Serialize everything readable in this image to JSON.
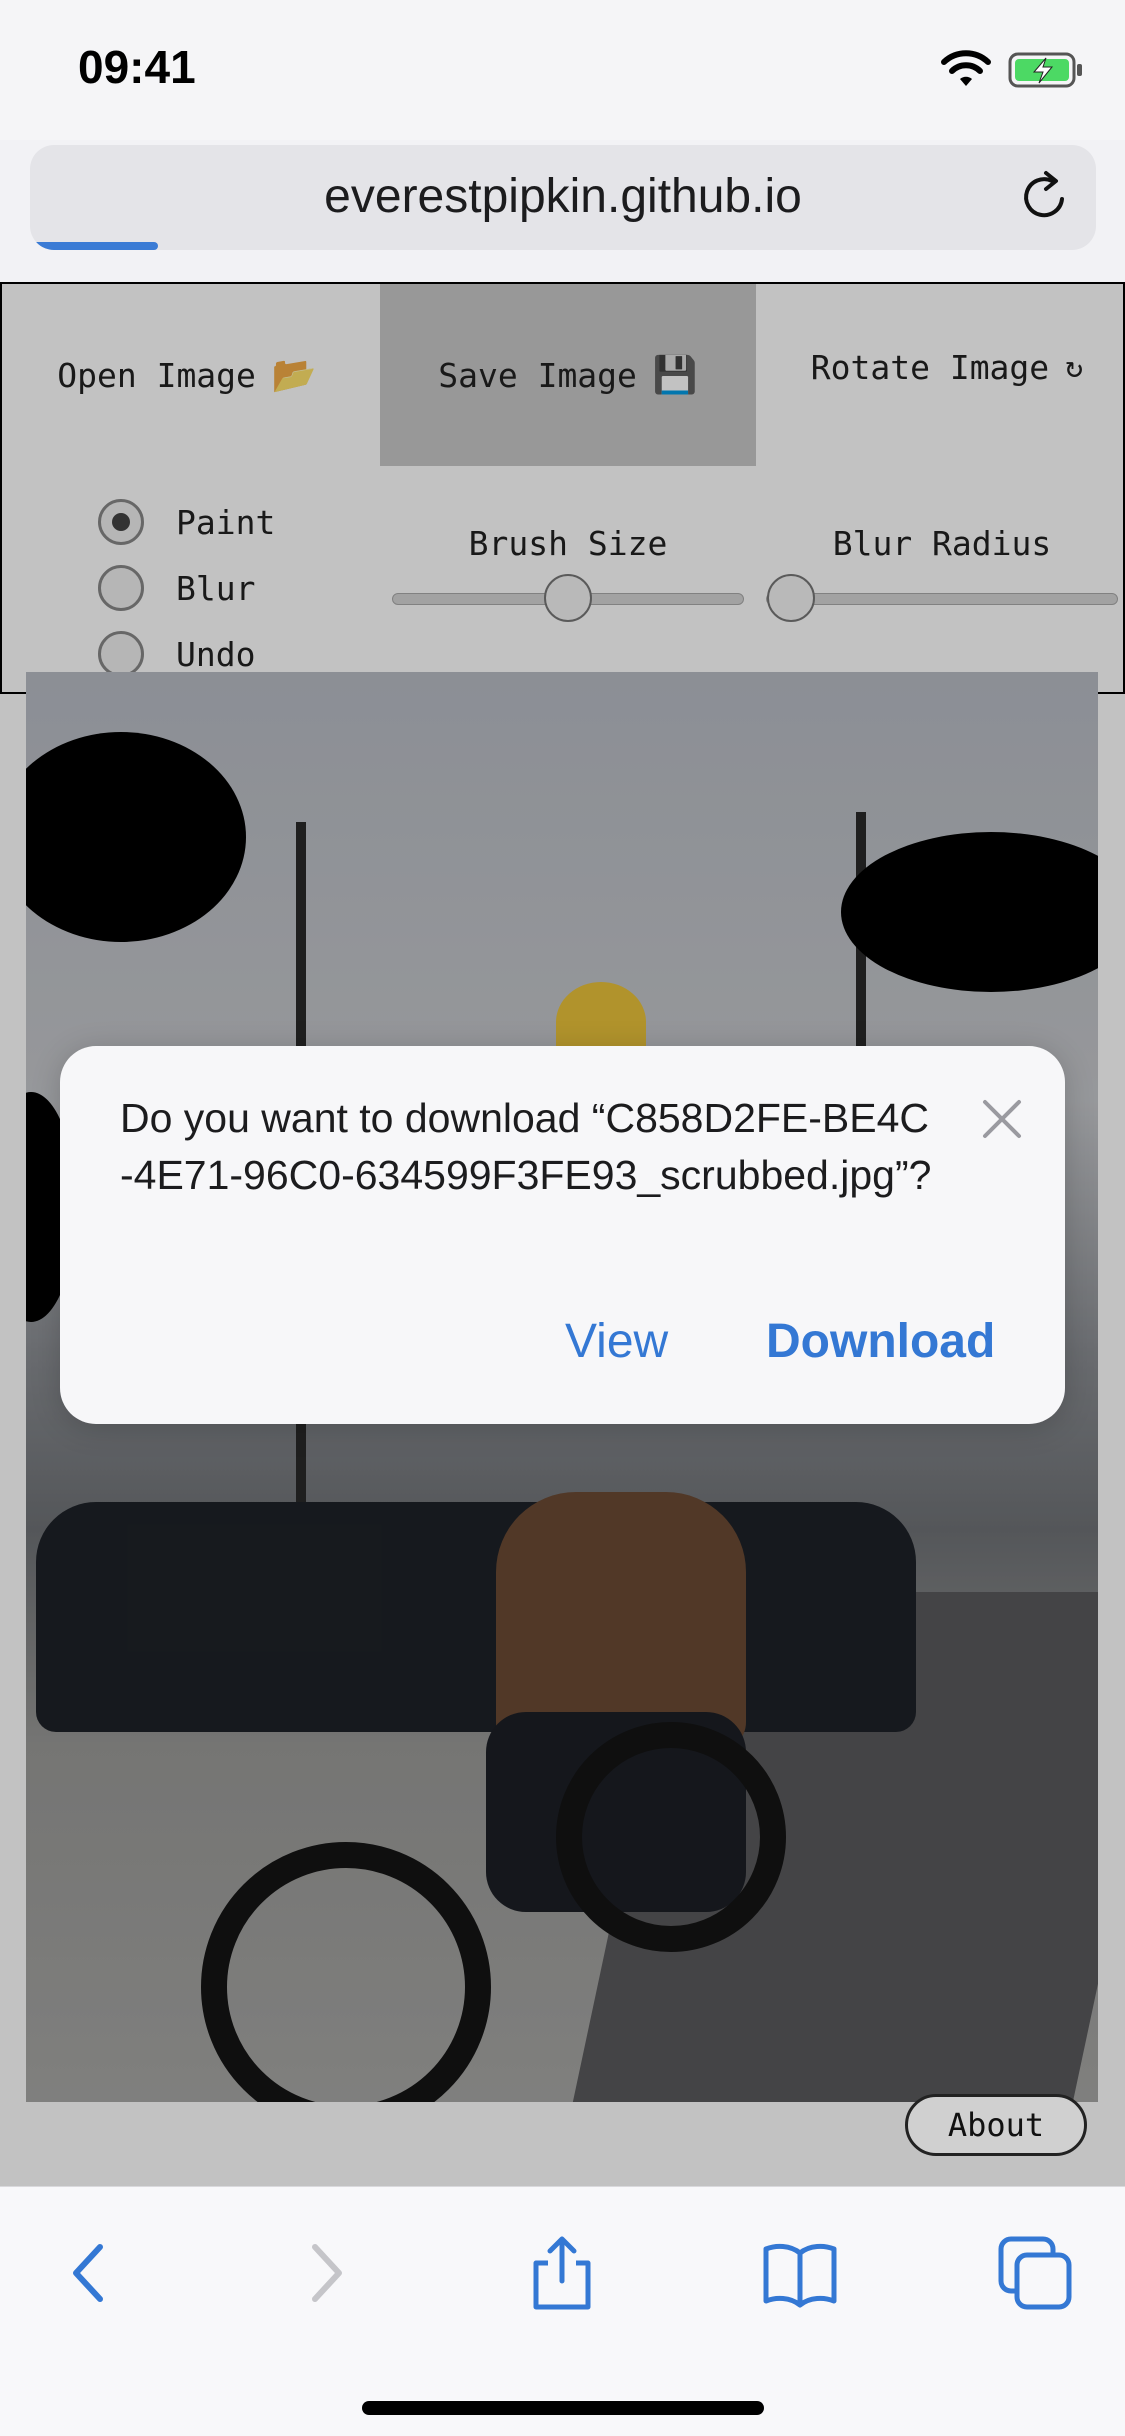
{
  "status_bar": {
    "time": "09:41",
    "icons": [
      "wifi-icon",
      "battery-charging-icon"
    ]
  },
  "browser": {
    "url": "everestpipkin.github.io",
    "load_progress": 0.12,
    "accent": "#3478d4"
  },
  "toolbar": {
    "open_label": "Open Image",
    "open_emoji": "📂",
    "save_label": "Save Image",
    "save_emoji": "💾",
    "rotate_label": "Rotate Image",
    "rotate_glyph": "↻"
  },
  "modes": {
    "options": [
      "Paint",
      "Blur",
      "Undo"
    ],
    "selected": "Paint"
  },
  "sliders": {
    "brush_size_label": "Brush Size",
    "brush_size_value": 0.5,
    "blur_radius_label": "Blur Radius",
    "blur_radius_value": 0.0
  },
  "about_label": "About",
  "dialog": {
    "message": "Do you want to download “C858D2FE-BE4C-4E71-96C0-634599F3FE93_scrubbed.jpg”?",
    "view_label": "View",
    "download_label": "Download"
  },
  "bottom_bar": {
    "icons": [
      "back-icon",
      "forward-icon",
      "share-icon",
      "bookmarks-icon",
      "tabs-icon"
    ]
  }
}
